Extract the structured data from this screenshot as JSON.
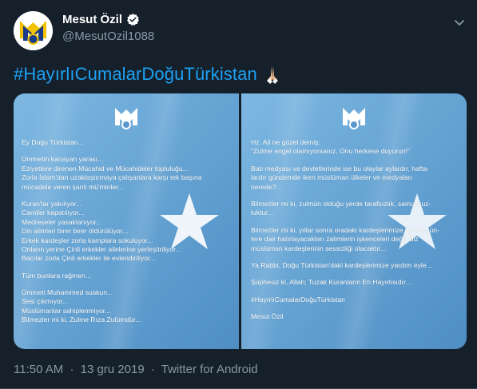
{
  "author": {
    "name": "Mesut Özil",
    "handle": "@MesutOzil1088",
    "verified": true
  },
  "tweet": {
    "text": "#HayırlıCumalarDoğuTürkistan",
    "emoji": "praying-hands"
  },
  "left_panel": {
    "lines": [
      "Ey Doğu Türkistan...",
      "",
      "Ümmetin kanayan yarası...",
      "Eziyetlere direnen Mücahid ve Mücahideler topluluğu...",
      "Zorla İslam'dan uzaklaştırmaya çalışanlara karşı tek başına",
      "mücadele veren şanlı mü'minler...",
      "",
      "Kuran'lar yakılıyor...",
      "Camiler kapatılıyor...",
      "Medreseler yasaklanıyor...",
      "Din alimleri birer birer öldürülüyor...",
      "Erkek kardeşler zorla kamplara sokuluyor...",
      "Onların yerine Çinli erkekler ailelerine yerleştiriliyor...",
      "Bacılar zorla Çinli erkekler ile evlendiriliyor...",
      "",
      "Tüm bunlara rağmen...",
      "",
      "Ümmeti Muhammed suskun...",
      "Sesi çıkmıyor...",
      "Müslümanlar sahiplenmiyor...",
      "Bilmezler mi ki, Zulme Rıza Zulümdür..."
    ]
  },
  "right_panel": {
    "lines": [
      "Hz. Ali ne güzel demiş:",
      "\"Zulme engel olamıyorsanız, Onu herkese duyurun!\"",
      "",
      "Batı medyası ve devletlerinde ise bu olaylar aylardır, hafta-",
      "lardır gündemde iken müslüman ülkeler ve medyaları",
      "nerede?...",
      "",
      "Bilmezler mi ki, zulmün olduğu yerde tarafsızlık, samussuz-",
      "luktur...",
      "",
      "Bilmezler mi ki, yıllar sonra oradaki kardeşlerimize bu acı gün-",
      "lere dair hatırlayacakları zalimlerin işkenceleri değil, biz",
      "müslüman kardeşlerinin sessizliği olacaktır...",
      "",
      "Ya Rabbi, Doğu Türkistan'daki kardeşlerimize yardım eyle...",
      "",
      "Şüphesiz ki, Allah; Tuzak Kuranların En Hayırlısıdır...",
      "",
      "#HayırlıCumalarDoğuTürkistan",
      "",
      "Mesut Özil"
    ]
  },
  "footer": {
    "time": "11:50 AM",
    "separator1": "·",
    "date": "13 gru 2019",
    "separator2": "·",
    "source": "Twitter for Android"
  },
  "colors": {
    "background": "#15202b",
    "link": "#1da1f2",
    "muted": "#8899a6",
    "flag_blue": "#6faad6",
    "logo_yellow": "#f2c200",
    "logo_navy": "#1a3a8a"
  }
}
